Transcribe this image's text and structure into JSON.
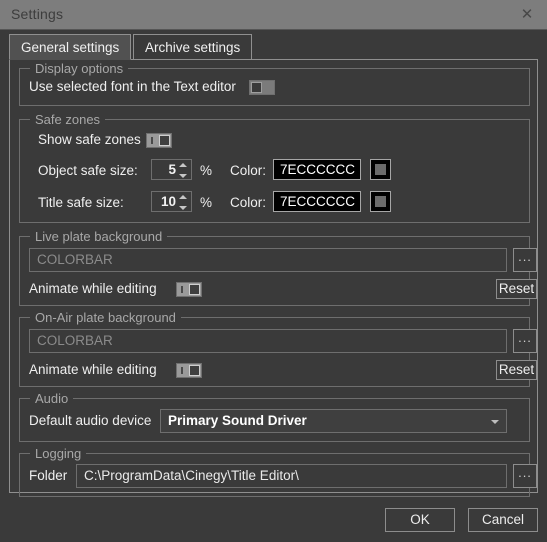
{
  "window": {
    "title": "Settings",
    "close_icon": "close-icon"
  },
  "tabs": [
    {
      "label": "General settings",
      "active": true
    },
    {
      "label": "Archive  settings",
      "active": false
    }
  ],
  "groups": {
    "display_options": {
      "legend": "Display options",
      "use_selected_font_label": "Use selected font in the Text editor",
      "use_selected_font_state": "off"
    },
    "safe_zones": {
      "legend": "Safe zones",
      "show_safe_zones_label": "Show safe zones",
      "show_safe_zones_state": "on",
      "object_safe_label": "Object safe size:",
      "object_safe_value": "5",
      "object_percent": "%",
      "object_color_label": "Color:",
      "object_color_value": "7ECCCCCC",
      "title_safe_label": "Title safe size:",
      "title_safe_value": "10",
      "title_percent": "%",
      "title_color_label": "Color:",
      "title_color_value": "7ECCCCCC"
    },
    "live_plate": {
      "legend": "Live plate background",
      "path_placeholder": "COLORBAR",
      "browse_label": "...",
      "animate_label": "Animate while editing",
      "animate_state": "on",
      "reset_label": "Reset"
    },
    "onair_plate": {
      "legend": "On-Air plate background",
      "path_placeholder": "COLORBAR",
      "browse_label": "...",
      "animate_label": "Animate while editing",
      "animate_state": "on",
      "reset_label": "Reset"
    },
    "audio": {
      "legend": "Audio",
      "device_label": "Default audio device",
      "device_value": "Primary Sound Driver"
    },
    "logging": {
      "legend": "Logging",
      "folder_label": "Folder",
      "folder_value": "C:\\ProgramData\\Cinegy\\Title Editor\\",
      "browse_label": "..."
    }
  },
  "footer": {
    "ok_label": "OK",
    "cancel_label": "Cancel"
  },
  "colors": {
    "titlebar": "#7d7d7d",
    "dialog_bg": "#3a3a3a",
    "tab_active_bg": "#515151",
    "group_border": "#6e6e6e",
    "text": "#efefef",
    "legend_text": "#a8a8a8",
    "color_field_bg": "#000000"
  }
}
